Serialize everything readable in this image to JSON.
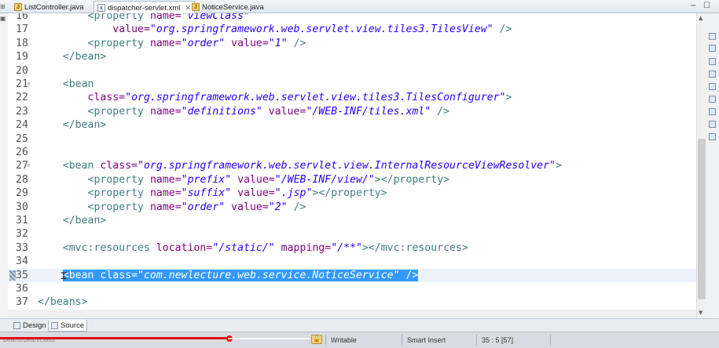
{
  "tabs": [
    {
      "label": "ListController.java",
      "icon": "java-file-icon"
    },
    {
      "label": "dispatcher-servlet.xml",
      "icon": "xml-file-icon",
      "active": true,
      "close": "✕"
    },
    {
      "label": "NoticeService.java",
      "icon": "java-file-icon"
    }
  ],
  "window_controls": {
    "minimize": "−",
    "maximize": "☐"
  },
  "code_lines": [
    {
      "n": "16",
      "indent": "    ",
      "parts": [
        [
          "tag",
          "<property "
        ],
        [
          "attr",
          "name="
        ],
        [
          "str",
          "\"viewClass\""
        ]
      ]
    },
    {
      "n": "17",
      "indent": "        ",
      "parts": [
        [
          "attr",
          "value="
        ],
        [
          "str",
          "\"org.springframework.web.servlet.view.tiles3.TilesView\""
        ],
        [
          "tag",
          " />"
        ]
      ]
    },
    {
      "n": "18",
      "indent": "    ",
      "parts": [
        [
          "tag",
          "<property "
        ],
        [
          "attr",
          "name="
        ],
        [
          "str",
          "\"order\""
        ],
        [
          "attr",
          " value="
        ],
        [
          "str",
          "\"1\""
        ],
        [
          "tag",
          " />"
        ]
      ]
    },
    {
      "n": "19",
      "indent": "",
      "parts": [
        [
          "tag",
          "</bean>"
        ]
      ]
    },
    {
      "n": "20",
      "indent": "",
      "parts": []
    },
    {
      "n": "21",
      "fold": true,
      "indent": "",
      "parts": [
        [
          "tag",
          "<bean"
        ]
      ]
    },
    {
      "n": "22",
      "indent": "    ",
      "parts": [
        [
          "attr",
          "class="
        ],
        [
          "str",
          "\"org.springframework.web.servlet.view.tiles3.TilesConfigurer\""
        ],
        [
          "tag",
          ">"
        ]
      ]
    },
    {
      "n": "23",
      "indent": "    ",
      "parts": [
        [
          "tag",
          "<property "
        ],
        [
          "attr",
          "name="
        ],
        [
          "str",
          "\"definitions\""
        ],
        [
          "attr",
          " value="
        ],
        [
          "str",
          "\"/WEB-INF/tiles.xml\""
        ],
        [
          "tag",
          " />"
        ]
      ]
    },
    {
      "n": "24",
      "indent": "",
      "parts": [
        [
          "tag",
          "</bean>"
        ]
      ]
    },
    {
      "n": "25",
      "indent": "",
      "parts": []
    },
    {
      "n": "26",
      "indent": "",
      "parts": []
    },
    {
      "n": "27",
      "fold": true,
      "indent": "",
      "parts": [
        [
          "tag",
          "<bean "
        ],
        [
          "attr",
          "class="
        ],
        [
          "str",
          "\"org.springframework.web.servlet.view.InternalResourceViewResolver\""
        ],
        [
          "tag",
          ">"
        ]
      ]
    },
    {
      "n": "28",
      "indent": "    ",
      "parts": [
        [
          "tag",
          "<property "
        ],
        [
          "attr",
          "name="
        ],
        [
          "str",
          "\"prefix\""
        ],
        [
          "attr",
          " value="
        ],
        [
          "str",
          "\"/WEB-INF/view/\""
        ],
        [
          "tag",
          "></property>"
        ]
      ]
    },
    {
      "n": "29",
      "indent": "    ",
      "parts": [
        [
          "tag",
          "<property "
        ],
        [
          "attr",
          "name="
        ],
        [
          "str",
          "\"suffix\""
        ],
        [
          "attr",
          " value="
        ],
        [
          "str",
          "\".jsp\""
        ],
        [
          "tag",
          "></property>"
        ]
      ]
    },
    {
      "n": "30",
      "indent": "    ",
      "parts": [
        [
          "tag",
          "<property "
        ],
        [
          "attr",
          "name="
        ],
        [
          "str",
          "\"order\""
        ],
        [
          "attr",
          " value="
        ],
        [
          "str",
          "\"2\""
        ],
        [
          "tag",
          " />"
        ]
      ]
    },
    {
      "n": "31",
      "indent": "",
      "parts": [
        [
          "tag",
          "</bean>"
        ]
      ]
    },
    {
      "n": "32",
      "indent": "",
      "parts": []
    },
    {
      "n": "33",
      "indent": "",
      "parts": [
        [
          "tag",
          "<mvc:resources "
        ],
        [
          "attr",
          "location="
        ],
        [
          "str",
          "\"/static/\""
        ],
        [
          "attr",
          " mapping="
        ],
        [
          "str",
          "\"/**\""
        ],
        [
          "tag",
          "></mvc:resources>"
        ]
      ]
    },
    {
      "n": "34",
      "indent": "",
      "parts": []
    },
    {
      "n": "35",
      "current": true,
      "selected": true,
      "indent": "",
      "parts": [
        [
          "tag",
          "<bean "
        ],
        [
          "attr",
          "class="
        ],
        [
          "str",
          "\"com.newlecture.web.service.NoticeService\""
        ],
        [
          "tag",
          " />"
        ]
      ]
    },
    {
      "n": "36",
      "indent": "",
      "parts": []
    },
    {
      "n": "37",
      "outer": true,
      "indent": "",
      "parts": [
        [
          "tag",
          "</beans>"
        ]
      ]
    }
  ],
  "bottom_tabs": [
    {
      "label": "Design",
      "icon": "design-tab-icon"
    },
    {
      "label": "Source",
      "icon": "source-tab-icon",
      "active": true
    }
  ],
  "status": {
    "breadcrumb": "beans/bean/class",
    "writable": "Writable",
    "insert_mode": "Smart Insert",
    "position": "35 : 5 [57]"
  },
  "colors": {
    "tag": "#3f7f7f",
    "attribute": "#7f007f",
    "string": "#2a00ff",
    "selection": "#3399ff",
    "video_progress": "#e51010"
  },
  "video_progress": 0.32
}
